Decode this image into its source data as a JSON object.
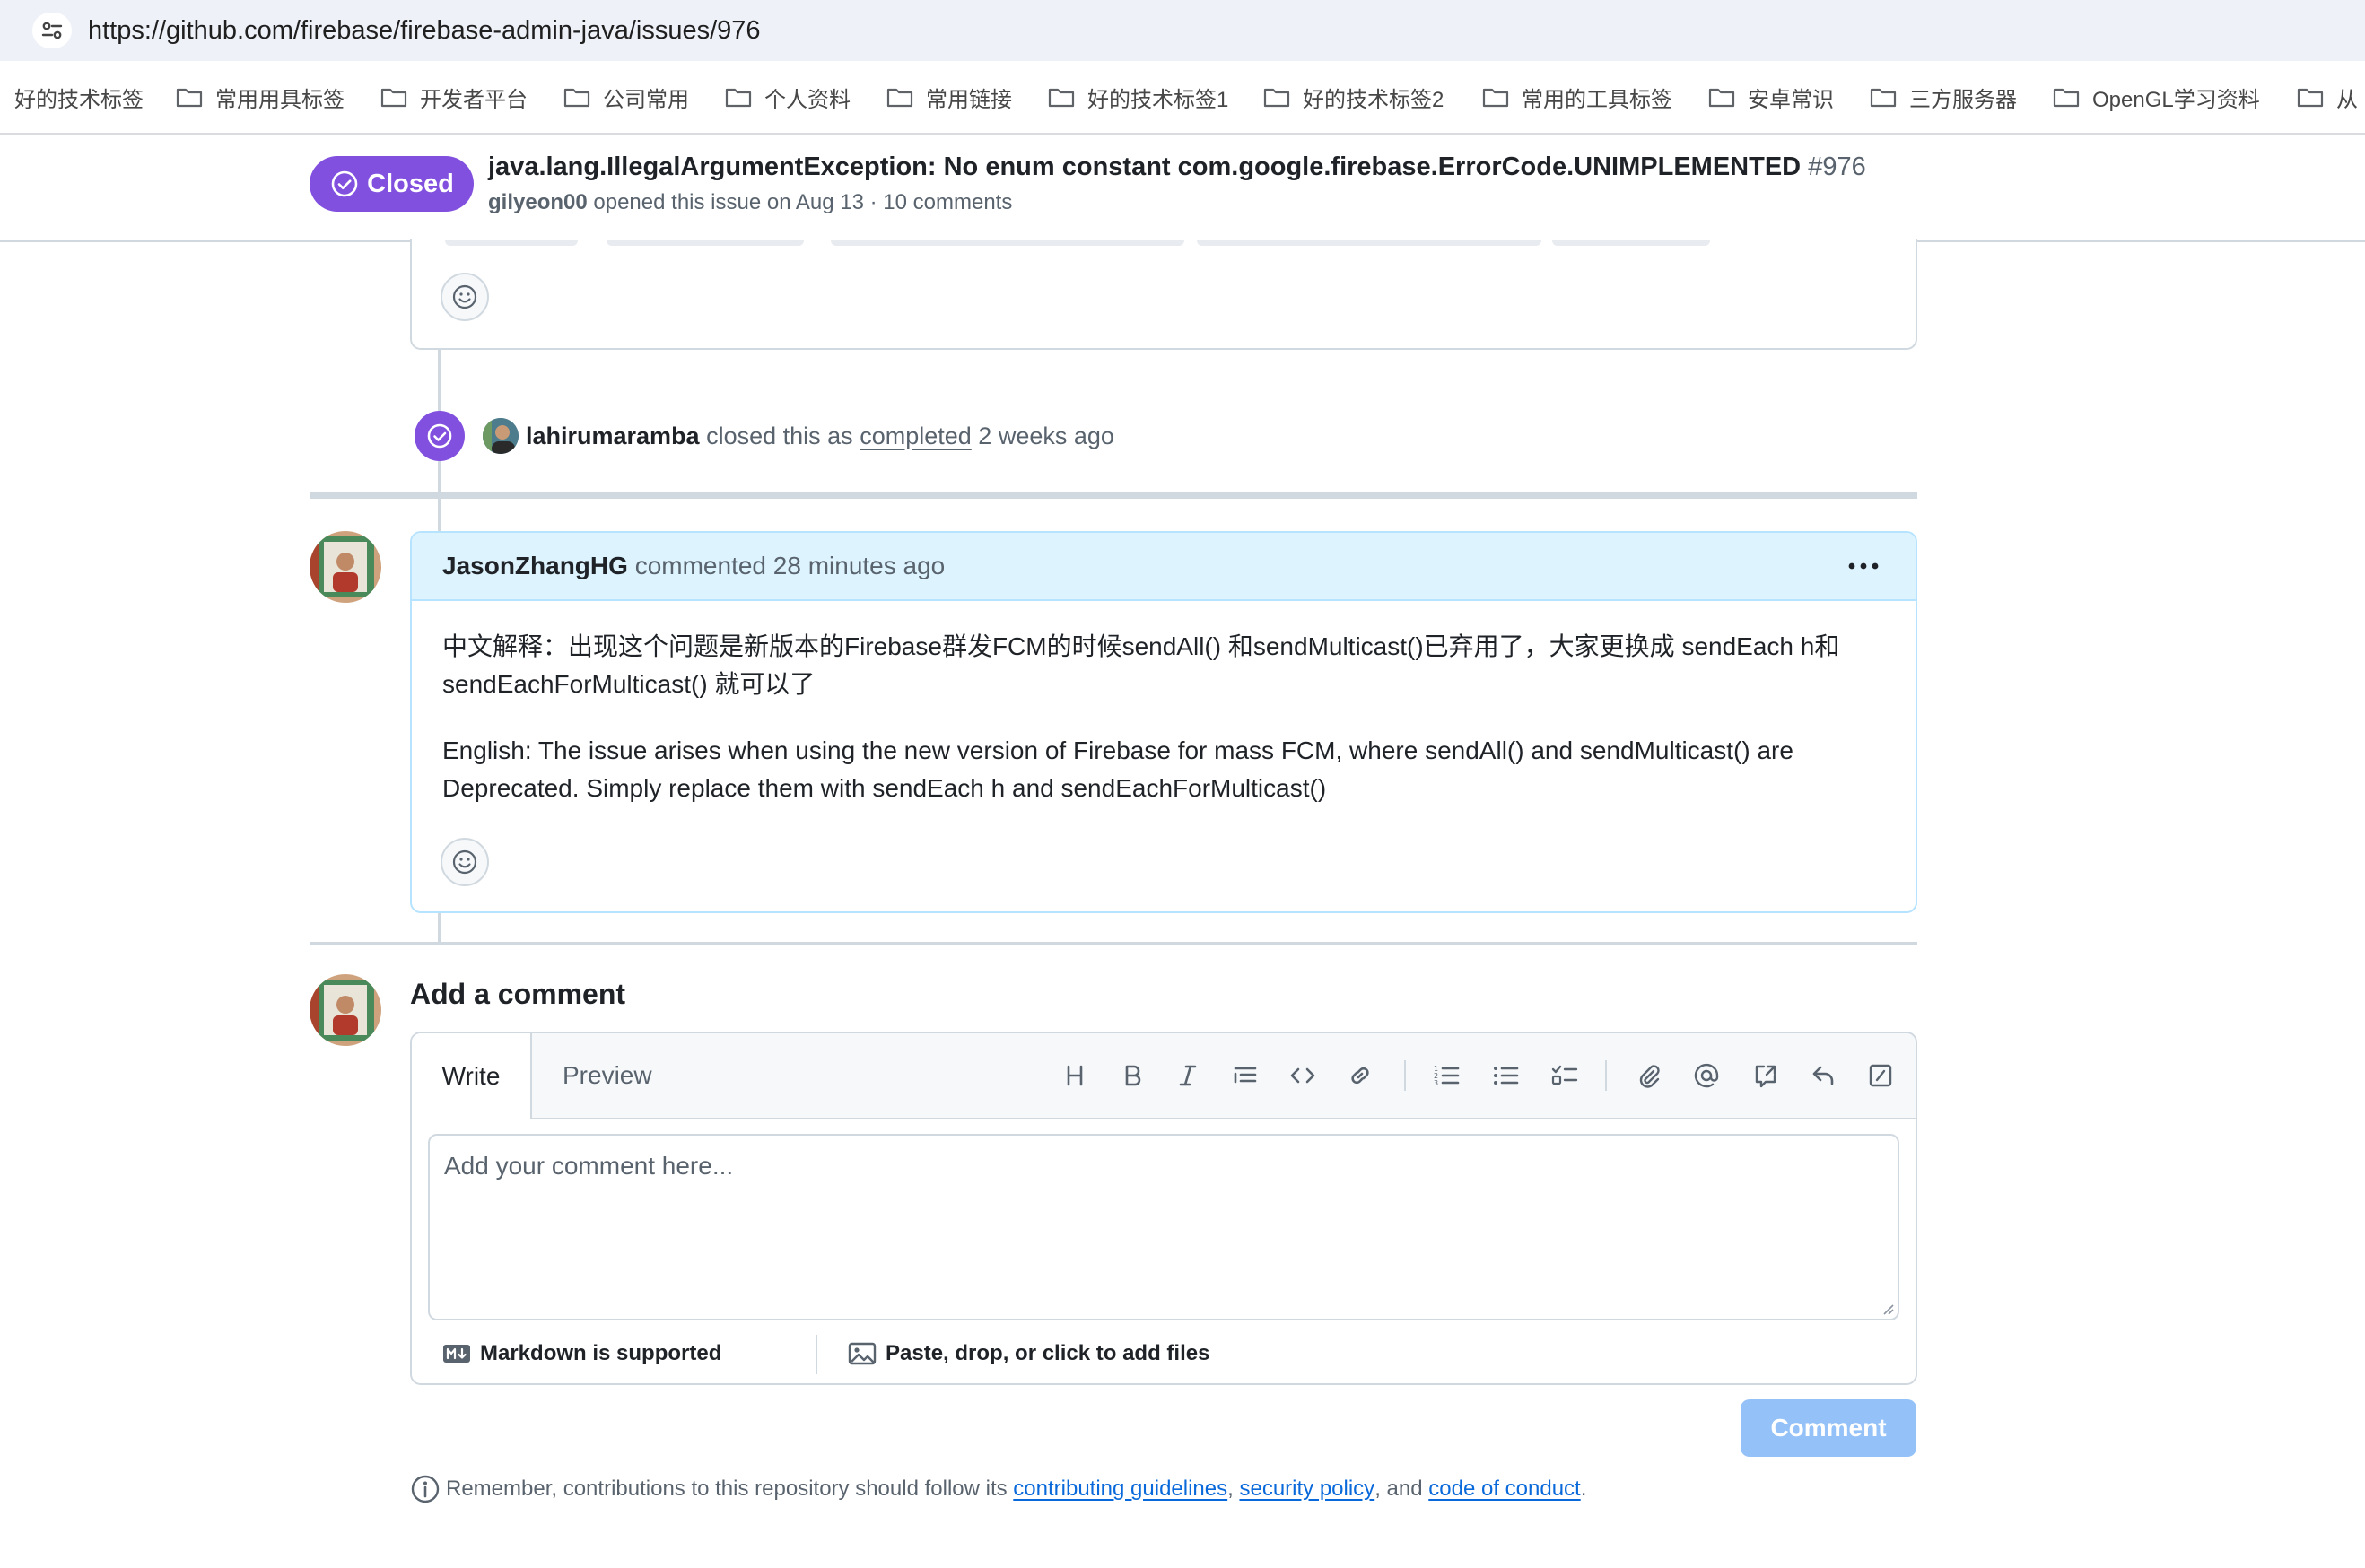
{
  "browser": {
    "url": "https://github.com/firebase/firebase-admin-java/issues/976",
    "bookmarks": [
      "好的技术标签",
      "常用用具标签",
      "开发者平台",
      "公司常用",
      "个人资料",
      "常用链接",
      "好的技术标签1",
      "好的技术标签2",
      "常用的工具标签",
      "安卓常识",
      "三方服务器",
      "OpenGL学习资料",
      "从"
    ]
  },
  "issue": {
    "state": "Closed",
    "title": "java.lang.IllegalArgumentException: No enum constant com.google.firebase.ErrorCode.UNIMPLEMENTED",
    "number": "#976",
    "author": "gilyeon00",
    "meta": "opened this issue on Aug 13 · 10 comments"
  },
  "close_event": {
    "actor": "lahirumaramba",
    "text_before": "closed this as",
    "link": "completed",
    "when": "2 weeks ago"
  },
  "comment": {
    "author": "JasonZhangHG",
    "meta": "commented 28 minutes ago",
    "paragraphs": [
      "中文解释：出现这个问题是新版本的Firebase群发FCM的时候sendAll() 和sendMulticast()已弃用了，大家更换成 sendEach h和sendEachForMulticast() 就可以了",
      "English: The issue arises when using the new version of Firebase for mass FCM, where sendAll() and sendMulticast() are Deprecated. Simply replace them with sendEach h and sendEachForMulticast()"
    ]
  },
  "add_comment": {
    "title": "Add a comment",
    "tabs": {
      "write": "Write",
      "preview": "Preview"
    },
    "placeholder": "Add your comment here...",
    "markdown_note": "Markdown is supported",
    "attach_note": "Paste, drop, or click to add files",
    "submit": "Comment"
  },
  "contrib": {
    "prefix": "Remember, contributions to this repository should follow its",
    "link1": "contributing guidelines",
    "sep1": ",",
    "link2": "security policy",
    "sep2": ", and",
    "link3": "code of conduct",
    "end": "."
  },
  "colors": {
    "closed": "#8250df",
    "link": "#0969da",
    "comment_header": "#ddf4ff",
    "button_disabled": "#94c2f8"
  },
  "icons": [
    "site-settings-icon",
    "folder-icon",
    "closed-issue-icon",
    "smiley-icon",
    "kebab-menu-icon",
    "heading-icon",
    "bold-icon",
    "italic-icon",
    "quote-icon",
    "code-icon",
    "link-icon",
    "ordered-list-icon",
    "unordered-list-icon",
    "task-list-icon",
    "attach-icon",
    "mention-icon",
    "reference-icon",
    "saved-reply-icon",
    "slash-command-icon",
    "markdown-icon",
    "image-icon",
    "info-icon"
  ]
}
